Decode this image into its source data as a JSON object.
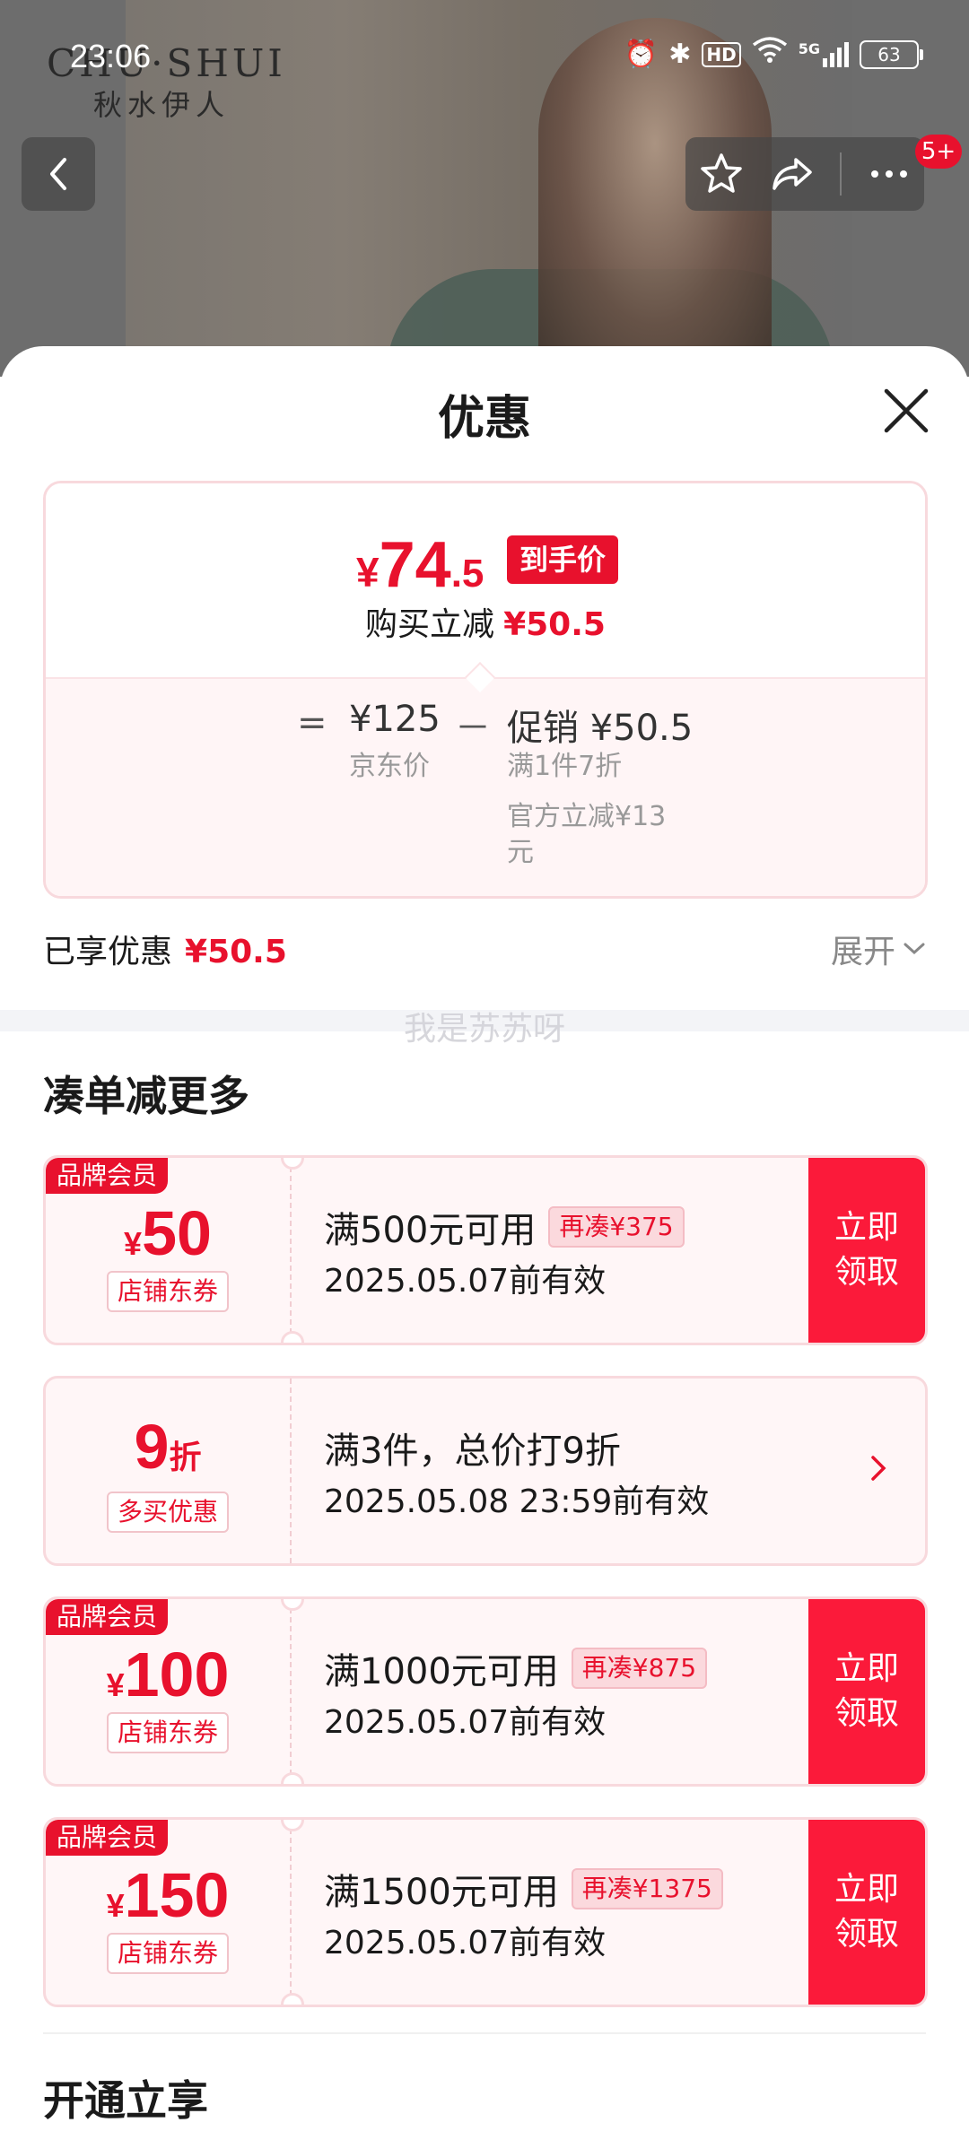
{
  "status_bar": {
    "time": "23:06",
    "network": "5G",
    "hd": "HD",
    "battery": "63"
  },
  "hero": {
    "brand_en": "CHU·SHUI",
    "brand_cn": "秋水伊人",
    "cart_badge": "5+"
  },
  "sheet": {
    "title": "优惠",
    "price_card": {
      "currency": "¥",
      "final_int": "74",
      "final_dec": ".5",
      "final_tag": "到手价",
      "reduce_label": "购买立减",
      "reduce_value": "¥50.5",
      "equals": "=",
      "jd_price": "¥125",
      "jd_label": "京东价",
      "minus": "－",
      "promo": "促销 ¥50.5",
      "promo_sub1": "满1件7折",
      "promo_sub2": "官方立减¥13元"
    },
    "enjoyed_label": "已享优惠",
    "enjoyed_value": "¥50.5",
    "expand_label": "展开",
    "watermark": "我是苏苏呀",
    "section_title": "凑单减更多",
    "coupons": [
      {
        "brand_tag": "品牌会员",
        "currency": "¥",
        "amount": "50",
        "type": "店铺东券",
        "condition": "满500元可用",
        "extra": "再凑¥375",
        "validity": "2025.05.07前有效",
        "claim": "立即领取"
      },
      {
        "amount": "9",
        "unit": "折",
        "type": "多买优惠",
        "condition": "满3件，总价打9折",
        "validity": "2025.05.08 23:59前有效"
      },
      {
        "brand_tag": "品牌会员",
        "currency": "¥",
        "amount": "100",
        "type": "店铺东券",
        "condition": "满1000元可用",
        "extra": "再凑¥875",
        "validity": "2025.05.07前有效",
        "claim": "立即领取"
      },
      {
        "brand_tag": "品牌会员",
        "currency": "¥",
        "amount": "150",
        "type": "店铺东券",
        "condition": "满1500元可用",
        "extra": "再凑¥1375",
        "validity": "2025.05.07前有效",
        "claim": "立即领取"
      }
    ],
    "section_title2": "开通立享"
  },
  "colors": {
    "accent": "#e8112d",
    "claim_bg": "#fb1a3a",
    "card_border": "#f8d9dd"
  },
  "icons": [
    "back-icon",
    "star-icon",
    "share-icon",
    "more-icon",
    "close-icon",
    "chevron-down-icon",
    "chevron-right-icon"
  ]
}
